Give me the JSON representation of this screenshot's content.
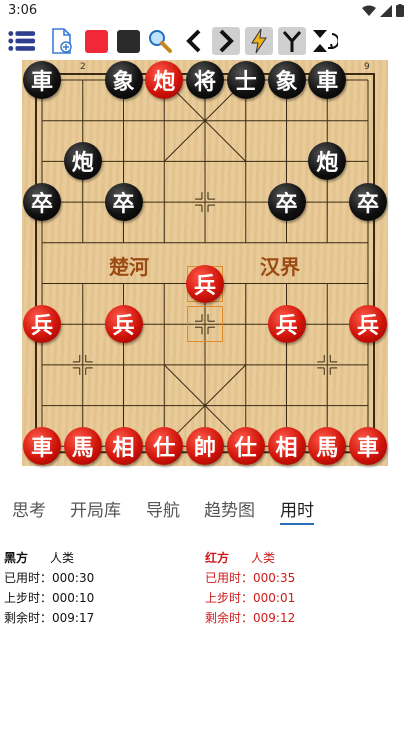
{
  "status": {
    "time": "3:06"
  },
  "toolbar": {
    "items": [
      "menu-icon",
      "new-file-icon",
      "red-square-icon",
      "black-square-icon",
      "search-icon",
      "back-icon",
      "forward-icon",
      "lightning-icon",
      "branch-icon",
      "flip-icon"
    ]
  },
  "board": {
    "river_left": "楚河",
    "river_right": "汉界",
    "coord_top_left": "2",
    "coord_top_right": "9",
    "pieces": [
      {
        "label": "車",
        "side": "black",
        "col": 0,
        "row": 0
      },
      {
        "label": "象",
        "side": "black",
        "col": 2,
        "row": 0
      },
      {
        "label": "炮",
        "side": "red",
        "col": 3,
        "row": 0
      },
      {
        "label": "将",
        "side": "black",
        "col": 4,
        "row": 0
      },
      {
        "label": "士",
        "side": "black",
        "col": 5,
        "row": 0
      },
      {
        "label": "象",
        "side": "black",
        "col": 6,
        "row": 0
      },
      {
        "label": "車",
        "side": "black",
        "col": 7,
        "row": 0
      },
      {
        "label": "炮",
        "side": "black",
        "col": 1,
        "row": 2
      },
      {
        "label": "炮",
        "side": "black",
        "col": 7,
        "row": 2
      },
      {
        "label": "卒",
        "side": "black",
        "col": 0,
        "row": 3
      },
      {
        "label": "卒",
        "side": "black",
        "col": 2,
        "row": 3
      },
      {
        "label": "卒",
        "side": "black",
        "col": 6,
        "row": 3
      },
      {
        "label": "卒",
        "side": "black",
        "col": 8,
        "row": 3
      },
      {
        "label": "兵",
        "side": "red",
        "col": 4,
        "row": 5
      },
      {
        "label": "兵",
        "side": "red",
        "col": 0,
        "row": 6
      },
      {
        "label": "兵",
        "side": "red",
        "col": 2,
        "row": 6
      },
      {
        "label": "兵",
        "side": "red",
        "col": 6,
        "row": 6
      },
      {
        "label": "兵",
        "side": "red",
        "col": 8,
        "row": 6
      },
      {
        "label": "車",
        "side": "red",
        "col": 0,
        "row": 9
      },
      {
        "label": "馬",
        "side": "red",
        "col": 1,
        "row": 9
      },
      {
        "label": "相",
        "side": "red",
        "col": 2,
        "row": 9
      },
      {
        "label": "仕",
        "side": "red",
        "col": 3,
        "row": 9
      },
      {
        "label": "帥",
        "side": "red",
        "col": 4,
        "row": 9
      },
      {
        "label": "仕",
        "side": "red",
        "col": 5,
        "row": 9
      },
      {
        "label": "相",
        "side": "red",
        "col": 6,
        "row": 9
      },
      {
        "label": "馬",
        "side": "red",
        "col": 7,
        "row": 9
      },
      {
        "label": "車",
        "side": "red",
        "col": 8,
        "row": 9
      }
    ],
    "last_move": {
      "from": {
        "col": 4,
        "row": 6
      },
      "to": {
        "col": 4,
        "row": 5
      }
    }
  },
  "tabs": [
    "思考",
    "开局库",
    "导航",
    "趋势图",
    "用时"
  ],
  "active_tab": "用时",
  "black": {
    "side": "黑方",
    "player": "人类",
    "used": "已用时：000:30",
    "last": "上步时：000:10",
    "remain": "剩余时：009:17"
  },
  "red": {
    "side": "红方",
    "player": "人类",
    "used": "已用时：000:35",
    "last": "上步时：000:01",
    "remain": "剩余时：009:12"
  },
  "colors": {
    "red_text": "#d01a1a",
    "black_text": "#111111",
    "board": "#e7c893"
  }
}
